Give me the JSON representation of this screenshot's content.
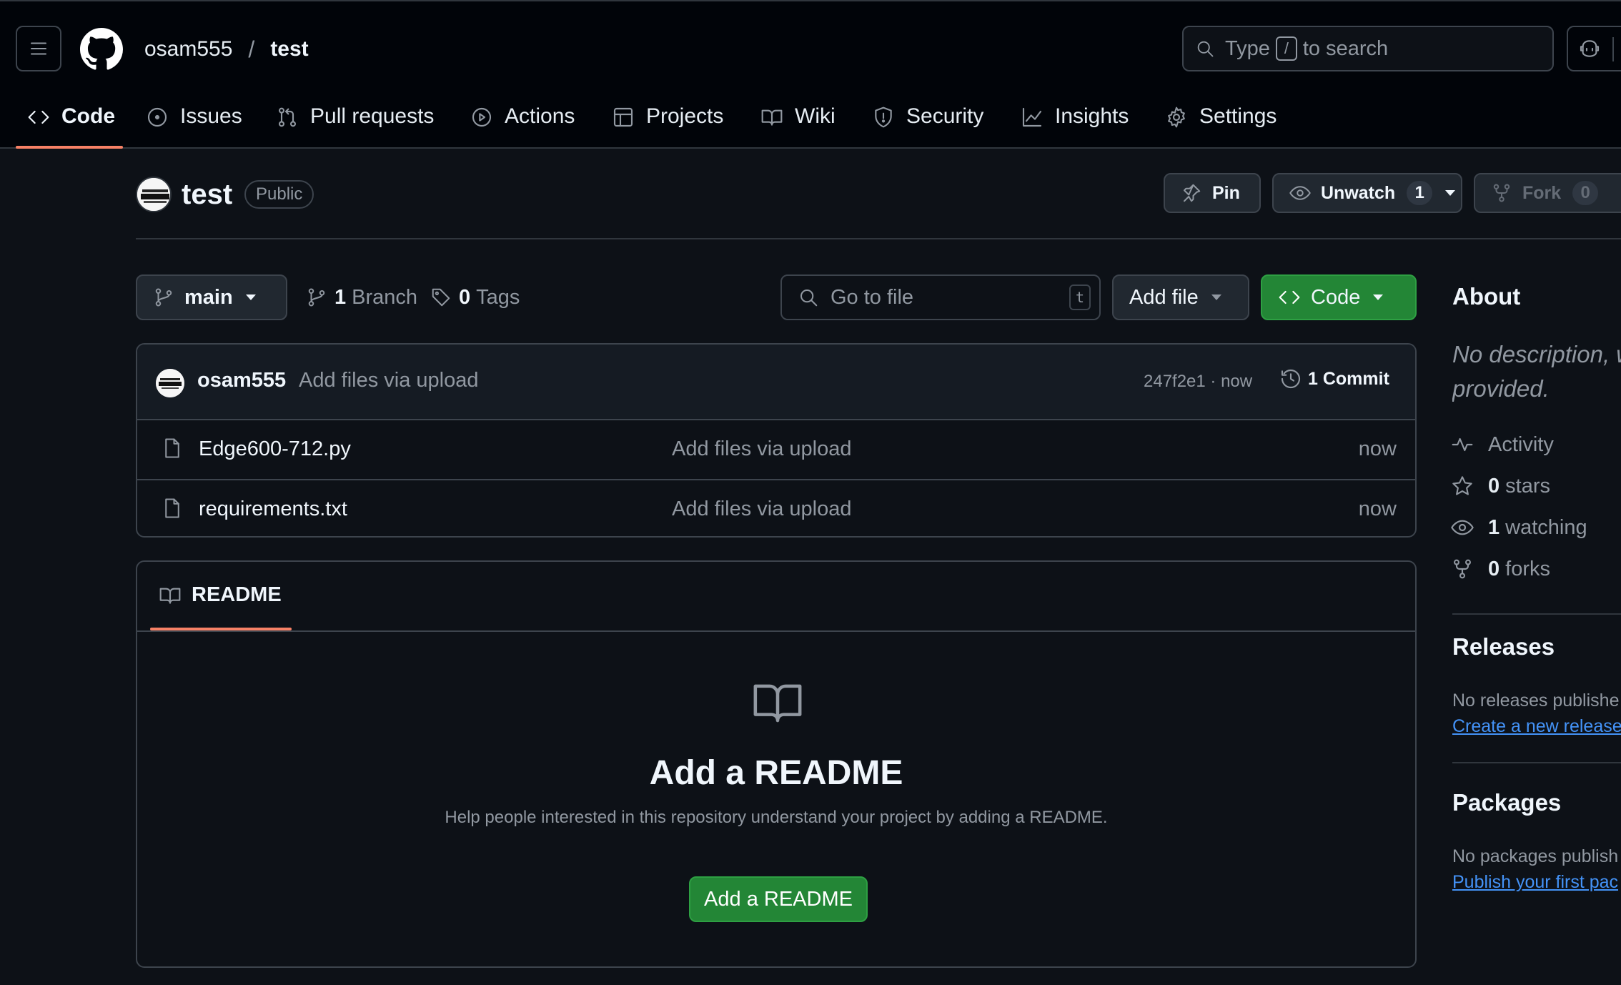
{
  "header": {
    "owner": "osam555",
    "separator": "/",
    "repo": "test",
    "search": {
      "prefix": "Type",
      "key": "/",
      "suffix": "to search"
    }
  },
  "nav": {
    "tabs": [
      {
        "label": "Code",
        "icon": "code-icon",
        "active": true
      },
      {
        "label": "Issues",
        "icon": "issue-icon"
      },
      {
        "label": "Pull requests",
        "icon": "pull-request-icon"
      },
      {
        "label": "Actions",
        "icon": "play-icon"
      },
      {
        "label": "Projects",
        "icon": "table-icon"
      },
      {
        "label": "Wiki",
        "icon": "book-icon"
      },
      {
        "label": "Security",
        "icon": "shield-icon"
      },
      {
        "label": "Insights",
        "icon": "graph-icon"
      },
      {
        "label": "Settings",
        "icon": "gear-icon"
      }
    ]
  },
  "repo": {
    "title": "test",
    "visibility": "Public",
    "pin_label": "Pin",
    "unwatch_label": "Unwatch",
    "watch_count": "1",
    "fork_label": "Fork",
    "fork_count": "0"
  },
  "toolbar": {
    "branch": "main",
    "branch_count": "1",
    "branch_label": "Branch",
    "tag_count": "0",
    "tag_label": "Tags",
    "go_to_file_placeholder": "Go to file",
    "go_to_file_key": "t",
    "add_file_label": "Add file",
    "code_label": "Code"
  },
  "commit": {
    "author": "osam555",
    "message": "Add files via upload",
    "meta": "247f2e1 · now",
    "count_label": "1 Commit"
  },
  "files": [
    {
      "name": "Edge600-712.py",
      "commit": "Add files via upload",
      "time": "now"
    },
    {
      "name": "requirements.txt",
      "commit": "Add files via upload",
      "time": "now"
    }
  ],
  "readme": {
    "tab_label": "README",
    "heading": "Add a README",
    "help": "Help people interested in this repository understand your project by adding a README.",
    "button": "Add a README"
  },
  "sidebar": {
    "about_title": "About",
    "description_line1": "No description, w",
    "description_line2": "provided.",
    "stats": [
      {
        "icon": "pulse-icon",
        "value": "",
        "label": "Activity"
      },
      {
        "icon": "star-icon",
        "value": "0",
        "label": "stars"
      },
      {
        "icon": "eye-icon",
        "value": "1",
        "label": "watching"
      },
      {
        "icon": "fork-icon",
        "value": "0",
        "label": "forks"
      }
    ],
    "releases_title": "Releases",
    "releases_note": "No releases publishe",
    "releases_link": "Create a new release",
    "packages_title": "Packages",
    "packages_note": "No packages publish",
    "packages_link": "Publish your first pac"
  },
  "colors": {
    "background": "#0d1117",
    "header_background": "#010409",
    "accent_underline": "#f78166",
    "primary_green": "#238636",
    "link_blue": "#4493f8"
  }
}
